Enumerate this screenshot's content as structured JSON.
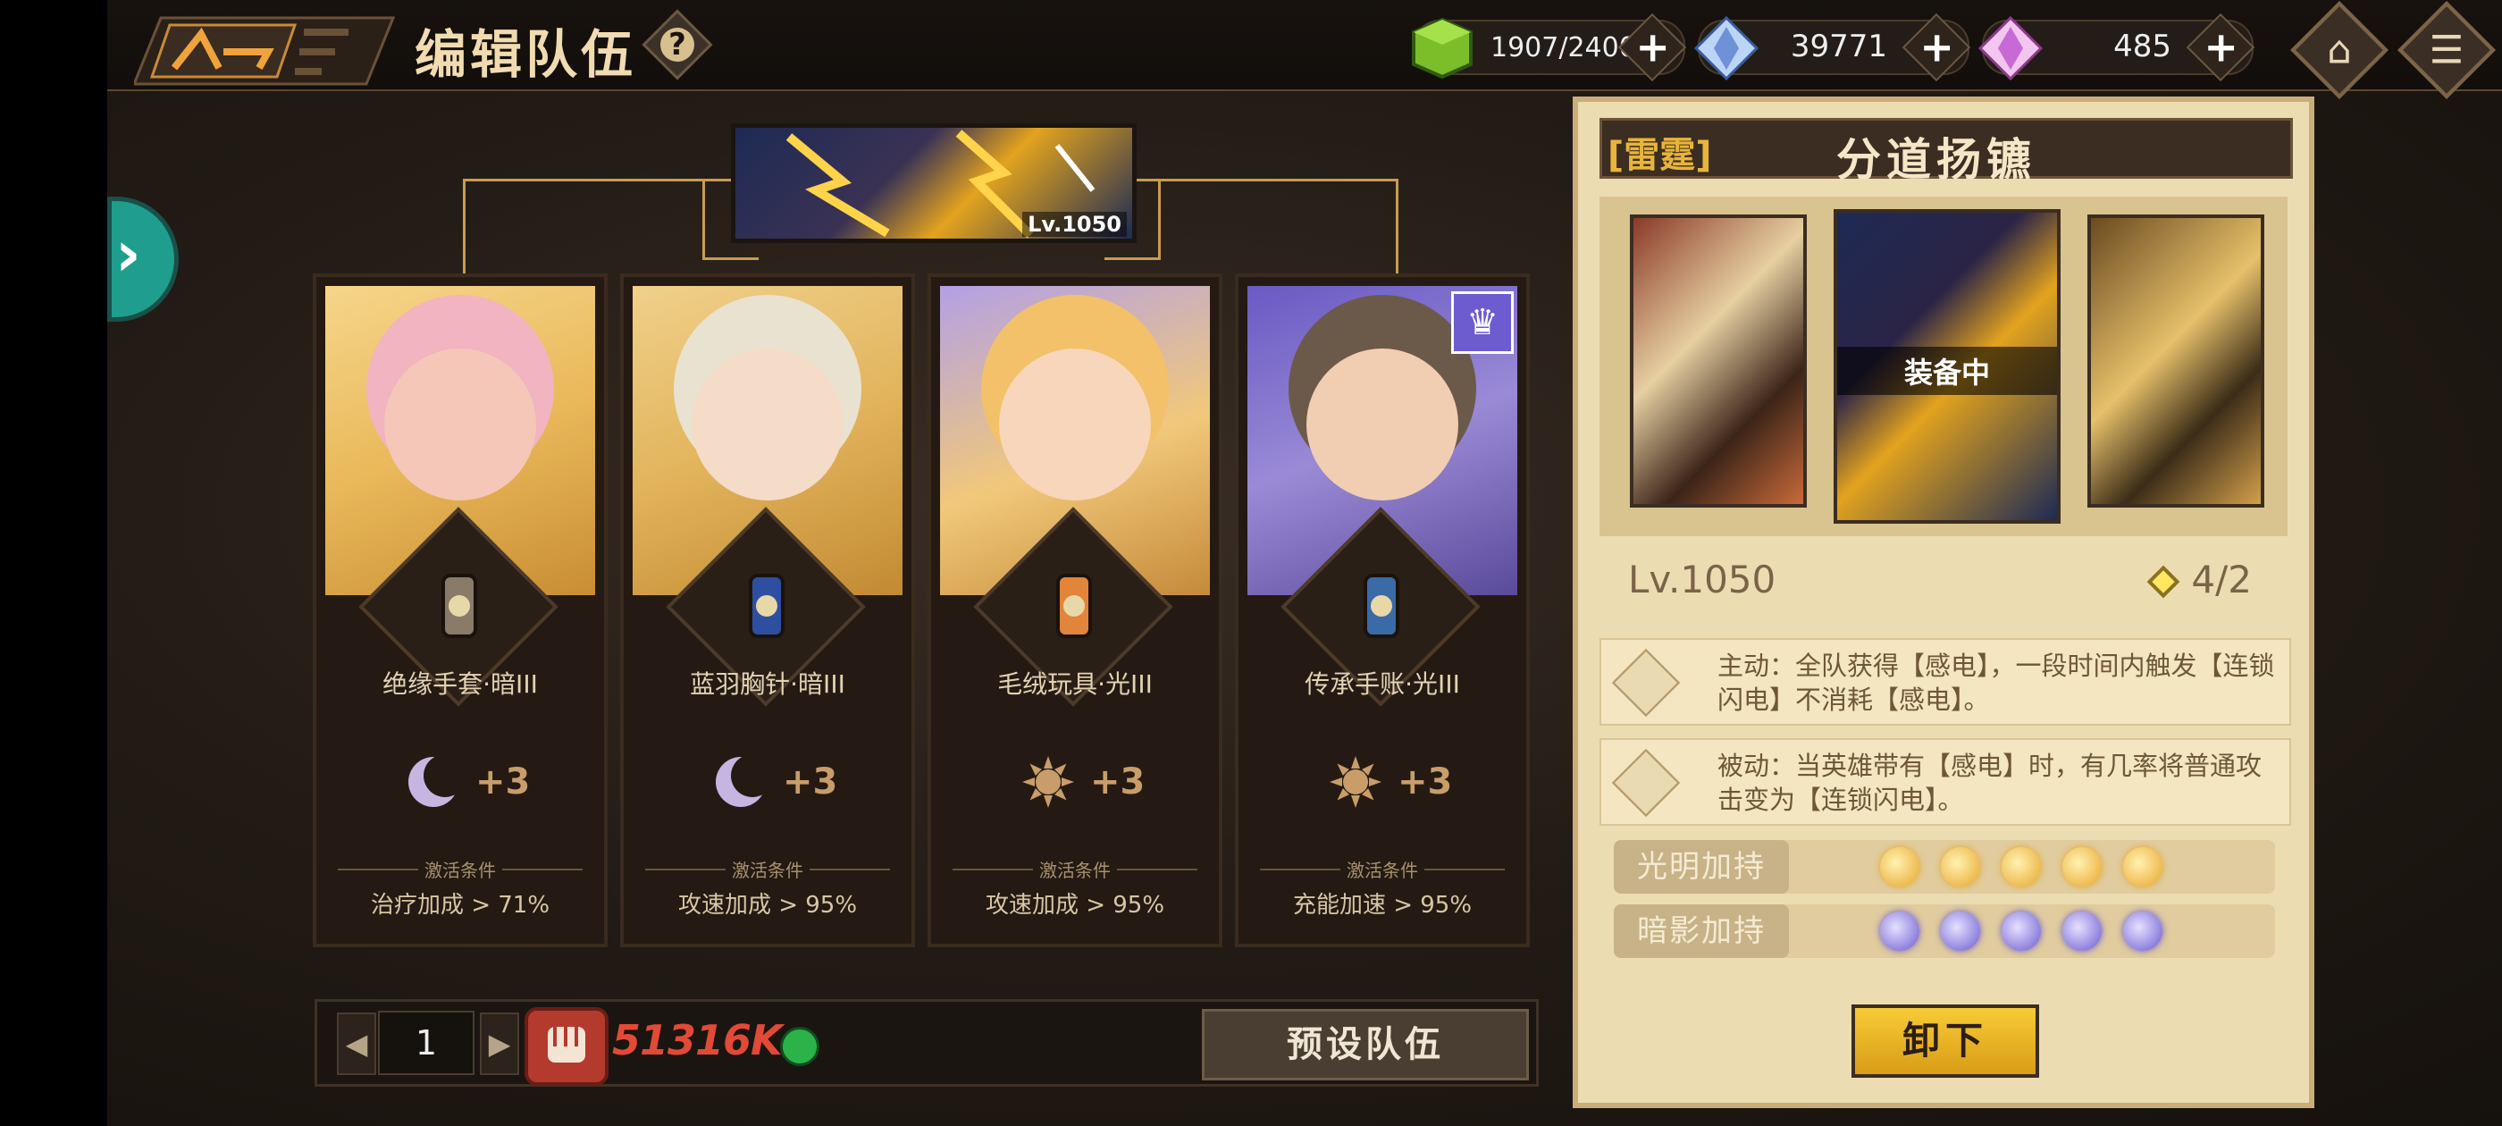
{
  "header": {
    "title": "编辑队伍",
    "help_label": "?"
  },
  "resources": [
    {
      "name": "stamina",
      "value": "1907/2400",
      "icon": "stamina-cube-icon"
    },
    {
      "name": "diamond-blue",
      "value": "39771",
      "icon": "blue-crystal-icon"
    },
    {
      "name": "diamond-pink",
      "value": "485",
      "icon": "pink-crystal-icon"
    }
  ],
  "plus_label": "+",
  "artifact": {
    "level": "Lv.1050"
  },
  "cards": [
    {
      "equipment": "绝缘手套·暗III",
      "element": "dark",
      "bonus": "+3",
      "cond_title": "激活条件",
      "condition": "治疗加成 > 71%"
    },
    {
      "equipment": "蓝羽胸针·暗III",
      "element": "dark",
      "bonus": "+3",
      "cond_title": "激活条件",
      "condition": "攻速加成 > 95%"
    },
    {
      "equipment": "毛绒玩具·光III",
      "element": "light",
      "bonus": "+3",
      "cond_title": "激活条件",
      "condition": "攻速加成 > 95%"
    },
    {
      "equipment": "传承手账·光III",
      "element": "light",
      "bonus": "+3",
      "cond_title": "激活条件",
      "condition": "充能加速 > 95%"
    }
  ],
  "bottom": {
    "page": "1",
    "power": "51316K",
    "preset_label": "预设队伍"
  },
  "panel": {
    "tag": "[雷霆]",
    "name": "分道扬镳",
    "equipped_label": "装备中",
    "level": "Lv.1050",
    "count": "4/2",
    "active_skill": "主动：全队获得【感电】，一段时间内触发【连锁闪电】不消耗【感电】。",
    "passive_skill": "被动：当英雄带有【感电】时，有几率将普通攻击变为【连锁闪电】。",
    "light_label": "光明加持",
    "dark_label": "暗影加持",
    "unload_label": "卸下"
  },
  "colors": {
    "accent_gold": "#e8b43a",
    "power_red": "#e14a36",
    "teal": "#1f9e8e"
  }
}
